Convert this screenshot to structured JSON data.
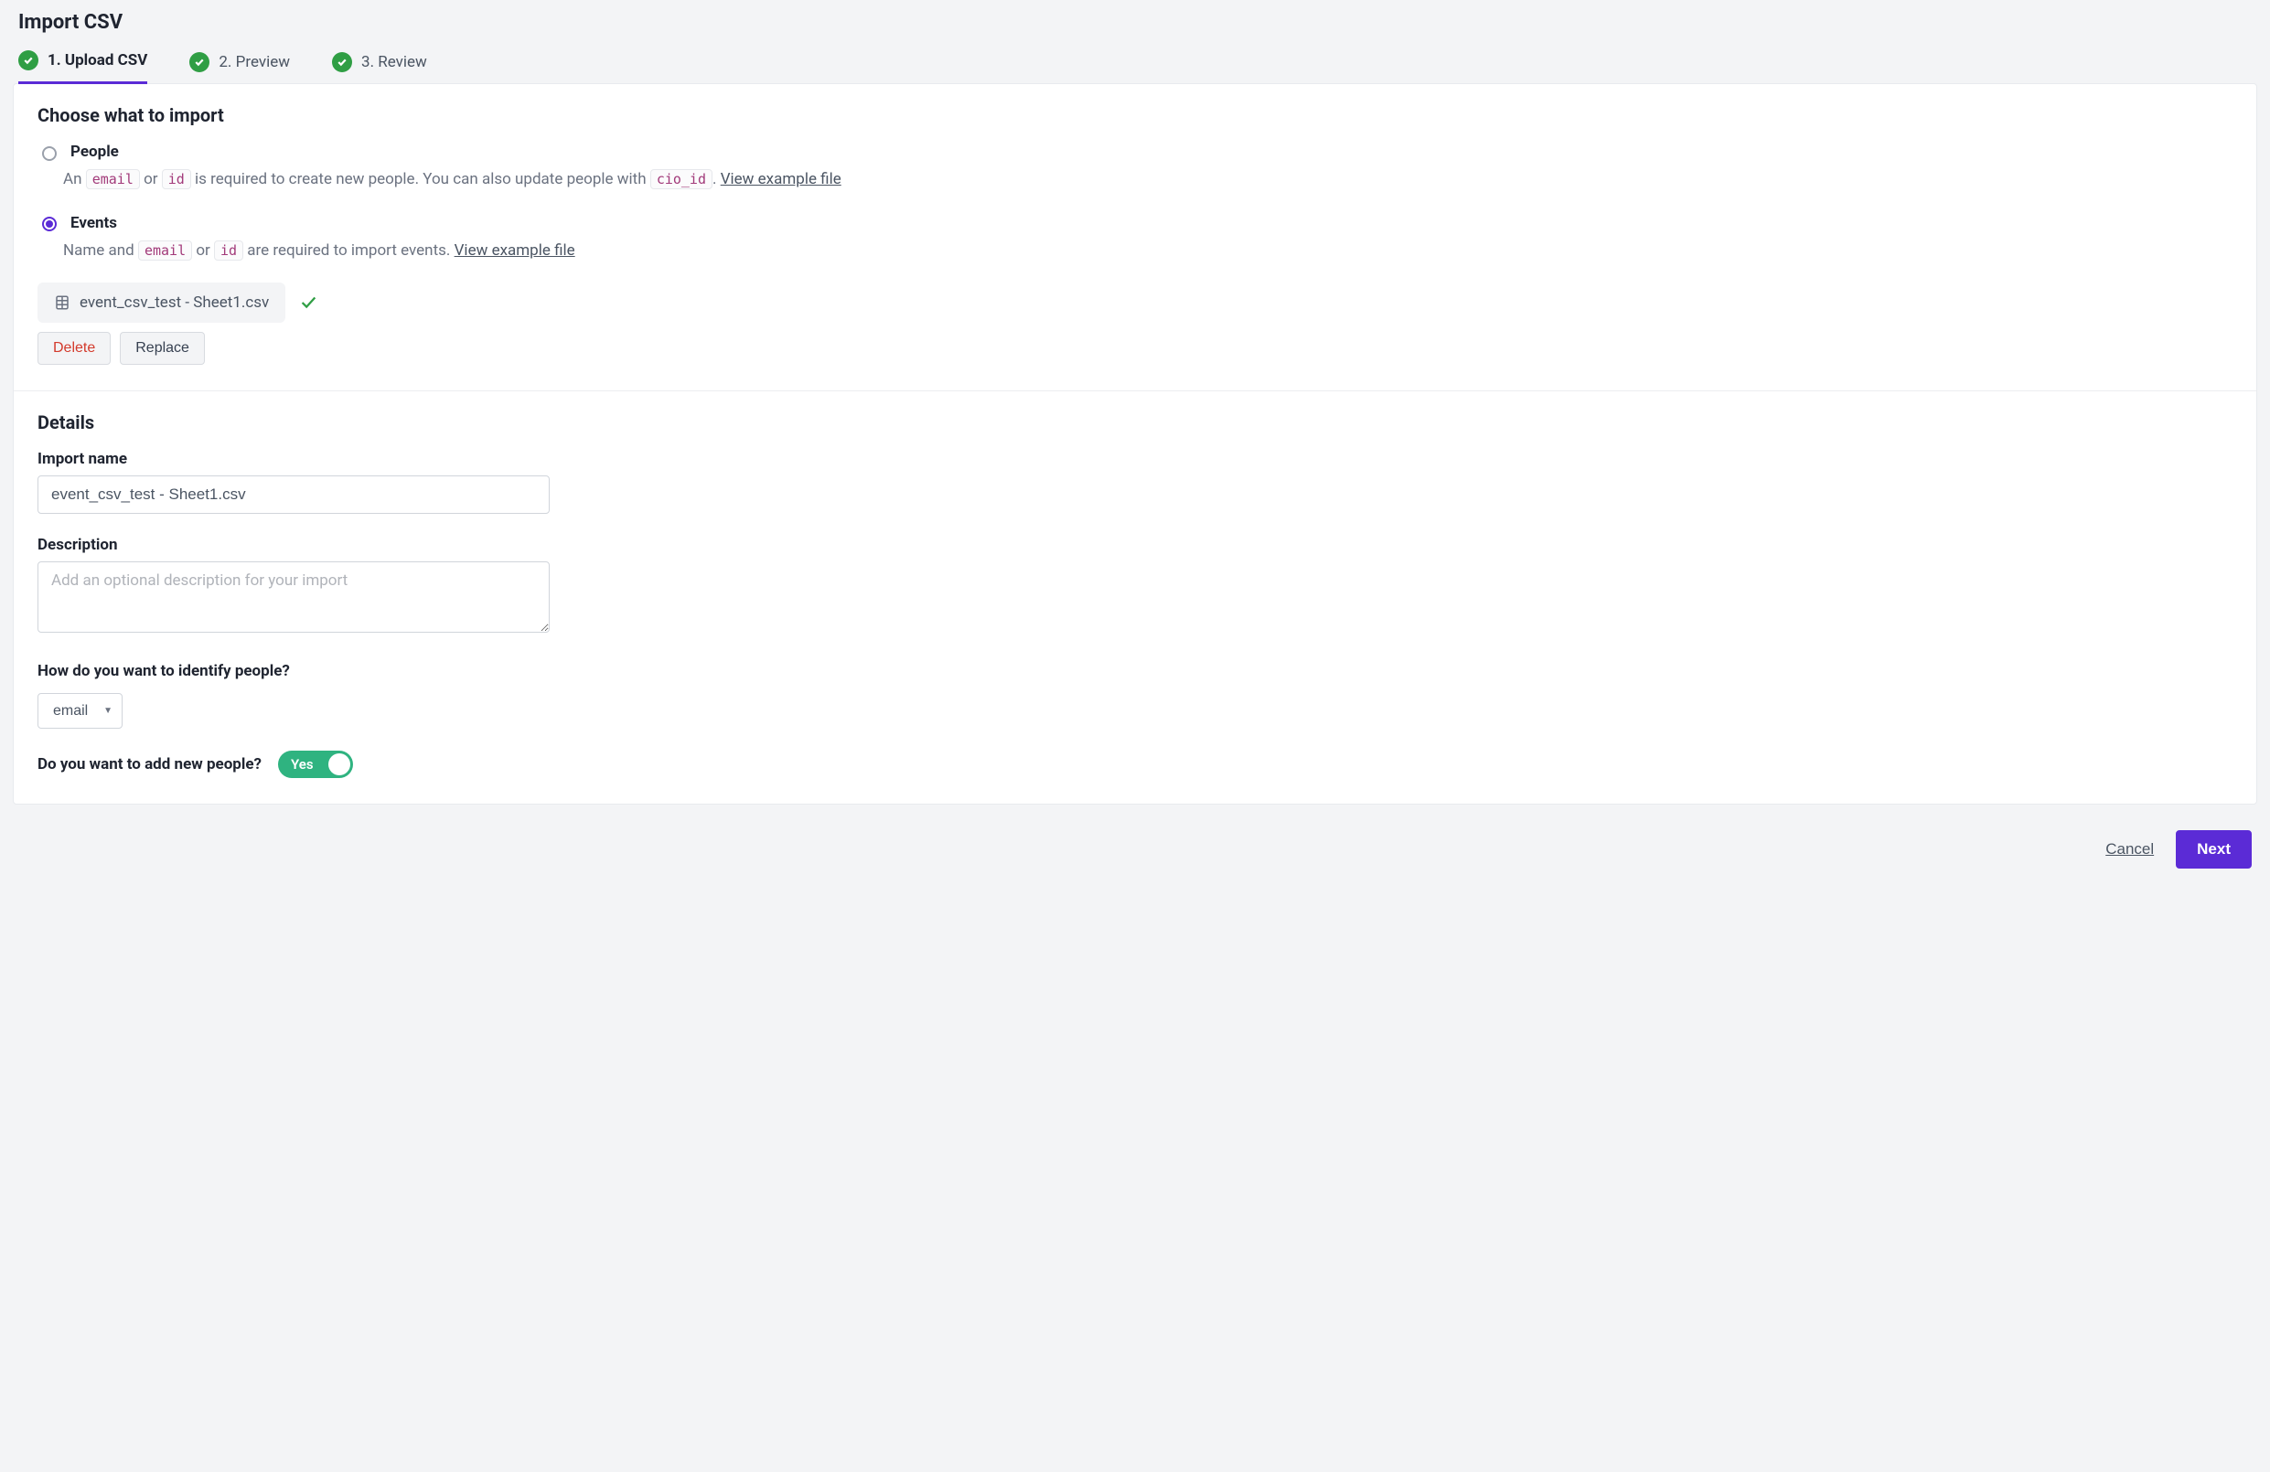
{
  "pageTitle": "Import CSV",
  "steps": [
    {
      "label": "1. Upload CSV",
      "active": true
    },
    {
      "label": "2. Preview",
      "active": false
    },
    {
      "label": "3. Review",
      "active": false
    }
  ],
  "choose": {
    "title": "Choose what to import",
    "people": {
      "label": "People",
      "desc_pre": "An ",
      "code1": "email",
      "or": " or ",
      "code2": "id",
      "desc_mid": " is required to create new people. You can also update people with ",
      "code3": "cio_id",
      "desc_post": ". ",
      "link": "View example file",
      "selected": false
    },
    "events": {
      "label": "Events",
      "desc_pre": "Name and ",
      "code1": "email",
      "or": " or ",
      "code2": "id",
      "desc_post": " are required to import events. ",
      "link": "View example file",
      "selected": true
    }
  },
  "file": {
    "name": "event_csv_test - Sheet1.csv",
    "deleteLabel": "Delete",
    "replaceLabel": "Replace"
  },
  "details": {
    "title": "Details",
    "importNameLabel": "Import name",
    "importNameValue": "event_csv_test - Sheet1.csv",
    "descriptionLabel": "Description",
    "descriptionPlaceholder": "Add an optional description for your import",
    "identifyLabel": "How do you want to identify people?",
    "identifyValue": "email",
    "addPeopleLabel": "Do you want to add new people?",
    "toggleText": "Yes"
  },
  "footer": {
    "cancel": "Cancel",
    "next": "Next"
  }
}
